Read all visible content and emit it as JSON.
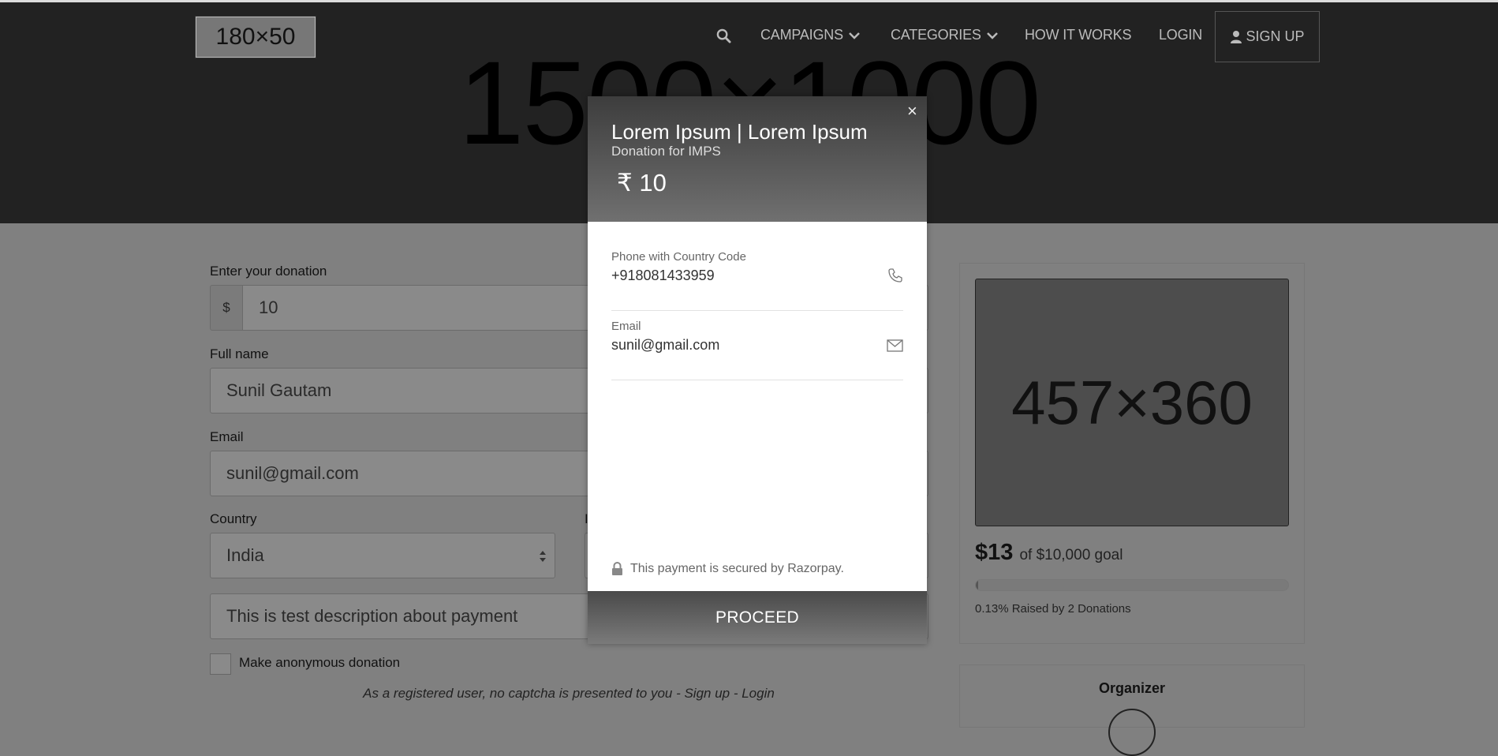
{
  "header": {
    "logo": "180×50",
    "hero_placeholder": "1500×1000",
    "nav": {
      "campaigns": "CAMPAIGNS",
      "categories": "CATEGORIES",
      "how_it_works": "HOW IT WORKS",
      "login": "LOGIN",
      "signup": "SIGN UP"
    }
  },
  "form": {
    "donation_label": "Enter your donation",
    "currency_addon": "$",
    "donation_value": "10",
    "fullname_label": "Full name",
    "fullname_value": "Sunil Gautam",
    "email_label": "Email",
    "email_value": "sunil@gmail.com",
    "country_label": "Country",
    "country_value": "India",
    "second_label_initial": "I",
    "description_value": "This is test description about payment",
    "anonymous_label": "Make anonymous donation",
    "registered_note": "As a registered user, no captcha is presented to you - Sign up - Login"
  },
  "sidebar": {
    "image_placeholder": "457×360",
    "raised_amount": "$13",
    "raised_goal": "of $10,000 goal",
    "progress_fraction": 0.0013,
    "raised_text": "0.13% Raised by 2 Donations",
    "organizer_title": "Organizer"
  },
  "modal": {
    "close": "×",
    "title": "Lorem Ipsum | Lorem Ipsum",
    "subtitle": "Donation for IMPS",
    "amount": "₹ 10",
    "phone_label": "Phone with Country Code",
    "phone_value": "+918081433959",
    "email_label": "Email",
    "email_value": "sunil@gmail.com",
    "secure_text": "This payment is secured by Razorpay.",
    "proceed_label": "PROCEED"
  },
  "icons": [
    "search-icon",
    "chevron-down-icon",
    "user-icon",
    "phone-icon",
    "mail-icon",
    "lock-icon",
    "close-icon",
    "select-arrows-icon"
  ]
}
